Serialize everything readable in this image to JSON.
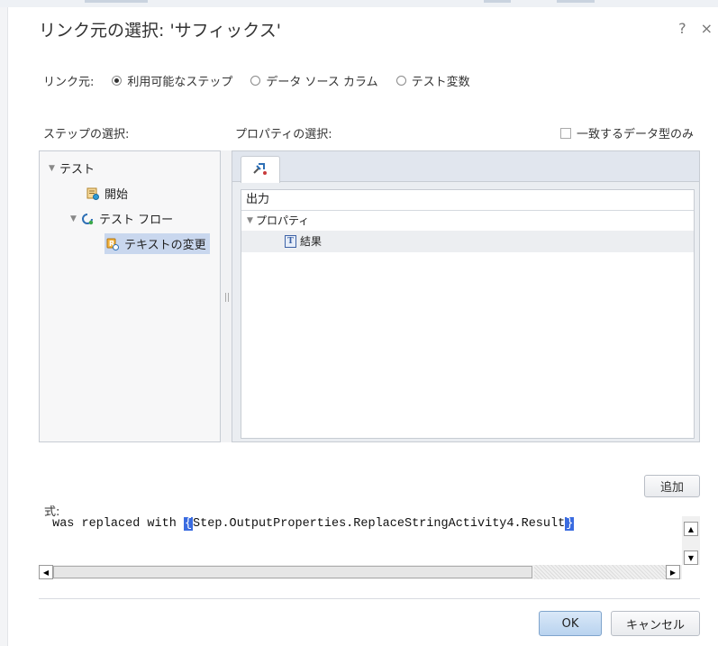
{
  "dialog": {
    "title": "リンク元の選択: 'サフィックス'",
    "help": "?",
    "close": "×"
  },
  "source": {
    "label": "リンク元:",
    "options": [
      {
        "label": "利用可能なステップ",
        "selected": true
      },
      {
        "label": "データ ソース カラム",
        "selected": false
      },
      {
        "label": "テスト変数",
        "selected": false
      }
    ]
  },
  "steps": {
    "label": "ステップの選択:",
    "tree": [
      {
        "label": "テスト",
        "expanded": true,
        "icon": "collapse-arrow"
      },
      {
        "label": "開始",
        "icon": "start-step-icon"
      },
      {
        "label": "テスト フロー",
        "expanded": true,
        "icon": "flow-icon"
      },
      {
        "label": "テキストの変更",
        "selected": true,
        "icon": "replace-text-activity-icon"
      }
    ]
  },
  "properties": {
    "label": "プロパティの選択:",
    "match_type_only": "一致するデータ型のみ",
    "tab_icon": "output-properties-icon",
    "header": "出力",
    "group": "プロパティ",
    "item": "結果",
    "item_badge": "T"
  },
  "expression": {
    "label": "式:",
    "add_button": "追加",
    "text_before": " was replaced with ",
    "open_bracket": "{",
    "token": "Step.OutputProperties.ReplaceStringActivity4.Result",
    "close_bracket": "}"
  },
  "footer": {
    "ok": "OK",
    "cancel": "キャンセル"
  }
}
